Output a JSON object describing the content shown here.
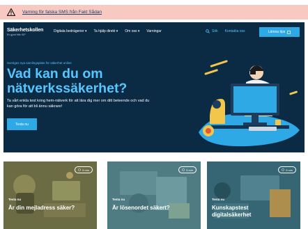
{
  "alert": {
    "icon": "warning-icon",
    "text": "Varning för falska SMS från Fakt Sådan"
  },
  "header": {
    "logo_name": "Säkerhetskollen",
    "logo_tagline": "En gjord från SIP",
    "nav": [
      {
        "label": "Digitala bedrägerier ▾"
      },
      {
        "label": "Ta hjälp direkt ▾"
      },
      {
        "label": "Om oss ▾"
      },
      {
        "label": "Varningar"
      }
    ],
    "search_label": "Sök",
    "contact_label": "Kontakta oss",
    "login_label": "Lämna tips",
    "colors": {
      "accent": "#57c6ff",
      "button": "#2fa8e6",
      "hero_bg": "#0b2a44"
    }
  },
  "hero": {
    "eyebrow": "Sveriges nya samlingsplats för säkerhet online",
    "title": "Vad kan du om nätverkssäkerhet?",
    "lead": "Ta vårt enkla test kring hem-nätverk för att lära dig mer om ditt beteende och vad du kan göra för att bli ännu säkrare!",
    "button": "Testa nu"
  },
  "cards": [
    {
      "time": "5 min",
      "label": "Testa nu",
      "title": "Är din mejladress säker?",
      "icon": "clock-icon",
      "bg": "#7a7a4e"
    },
    {
      "time": "5 min",
      "label": "Testa nu",
      "title": "Är lösenordet säkert?",
      "icon": "clock-icon",
      "bg": "#5a8c95"
    },
    {
      "time": "5 min",
      "label": "Testa nu",
      "title": "Kunskapstest digitalsäkerhet",
      "icon": "clock-icon",
      "bg": "#3e7585"
    }
  ]
}
